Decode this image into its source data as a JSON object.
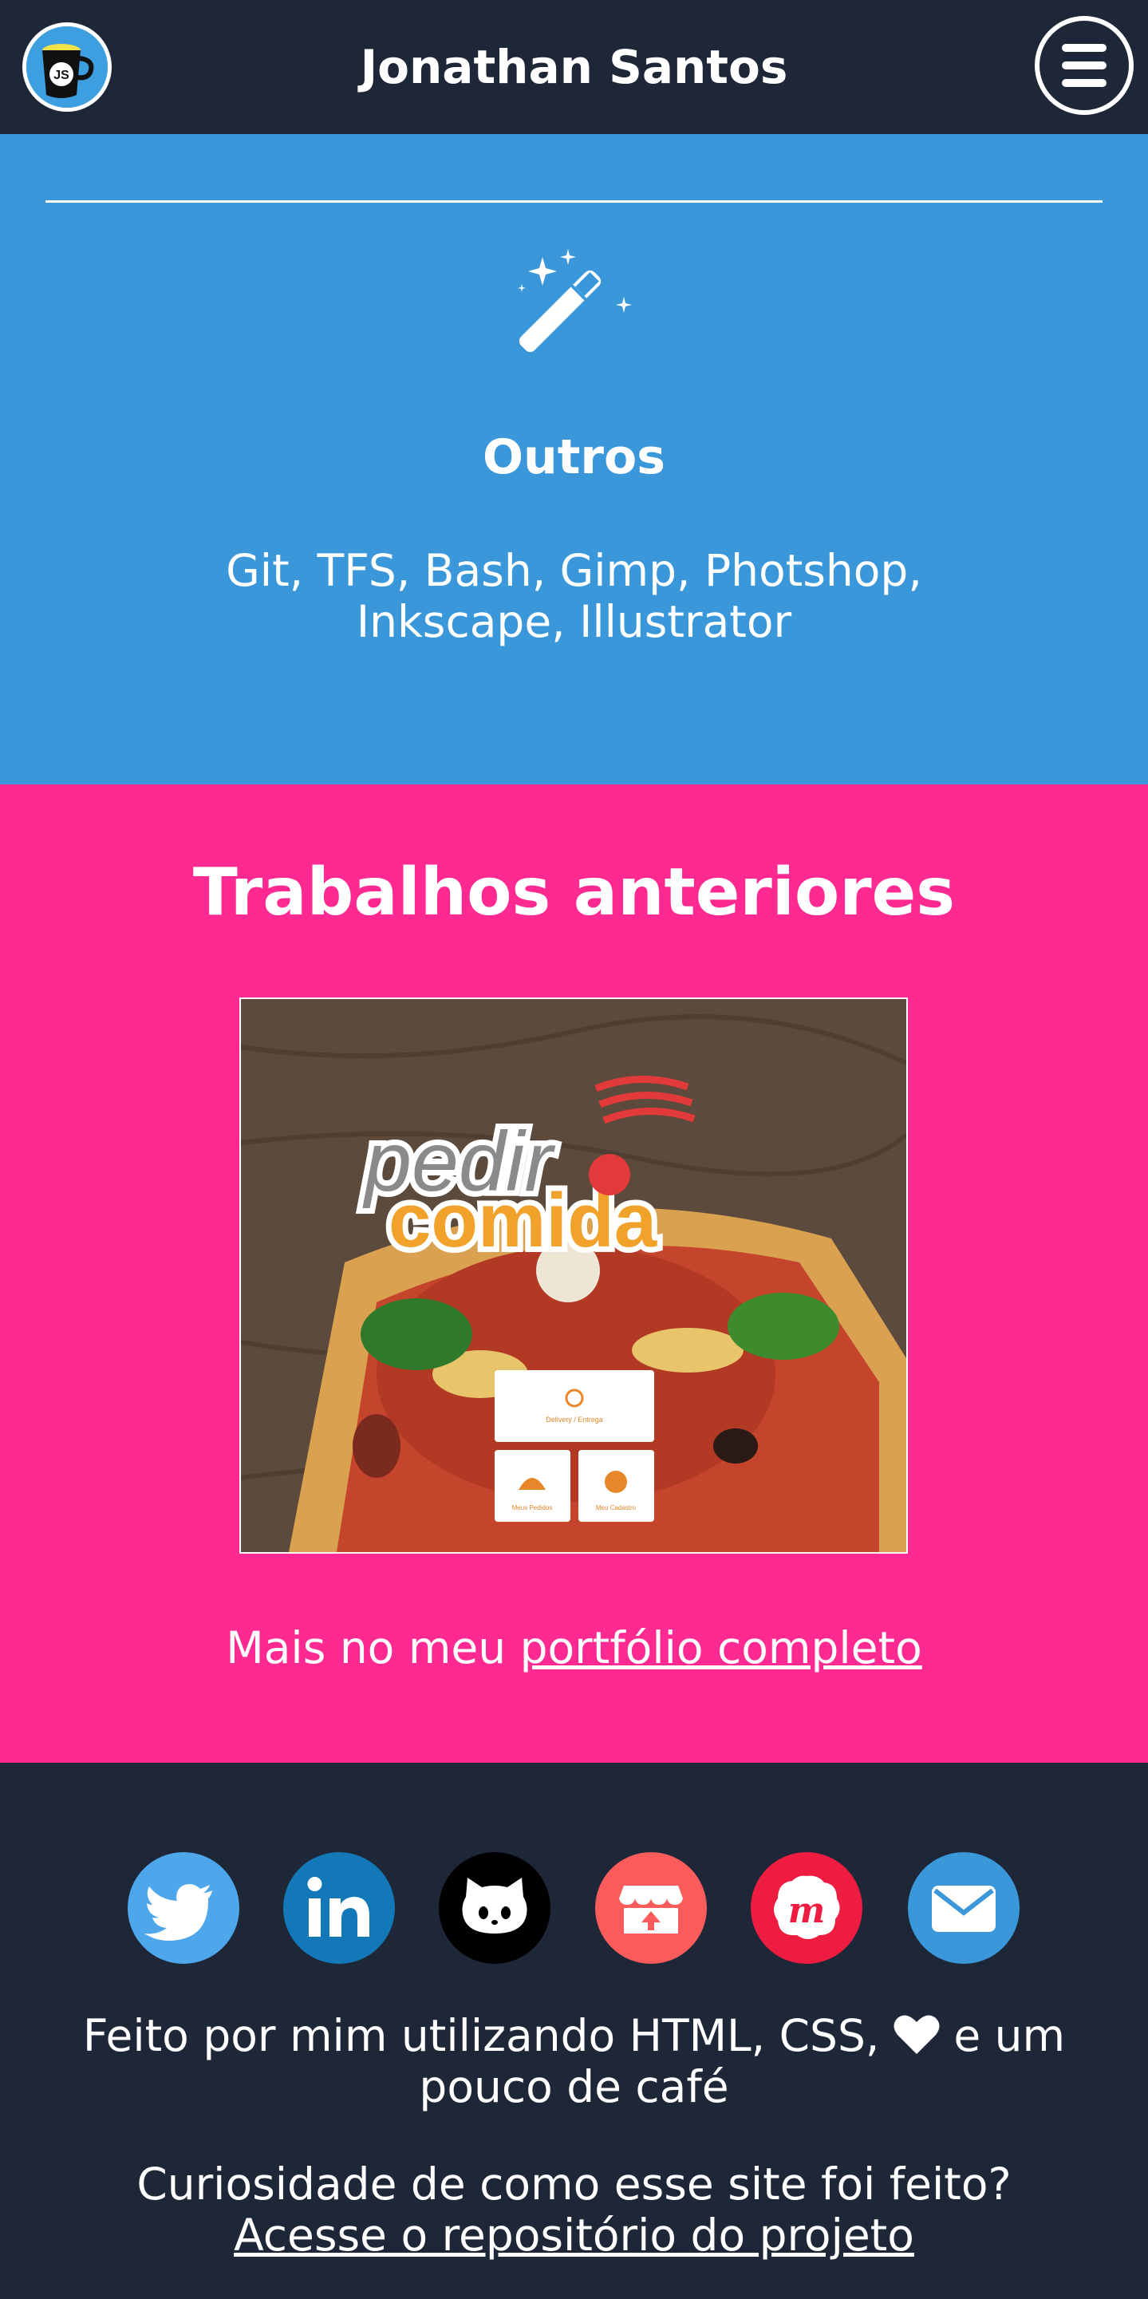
{
  "header": {
    "title": "Jonathan Santos",
    "logo_text": "JS",
    "logo_icon": "coffee-mug-logo-icon",
    "menu_icon": "hamburger-menu-icon"
  },
  "skills": {
    "icon": "magic-wand-icon",
    "title": "Outros",
    "text": "Git, TFS, Bash, Gimp, Photshop, Inkscape, Illustrator"
  },
  "works": {
    "title": "Trabalhos anteriores",
    "project": {
      "logo_line1": "pedir",
      "logo_line2": "comida",
      "card_delivery": "Delivery / Entrega",
      "card_menu": "Meus Pedidos",
      "card_account": "Meu Cadastro"
    },
    "more_prefix": "Mais no meu ",
    "more_link": "portfólio completo"
  },
  "footer": {
    "social": [
      {
        "name": "twitter-icon",
        "color": "#4da7ea"
      },
      {
        "name": "linkedin-icon",
        "color": "#1378b8"
      },
      {
        "name": "github-icon",
        "color": "#000000"
      },
      {
        "name": "itchio-icon",
        "color": "#fa5c5c"
      },
      {
        "name": "meetup-icon",
        "color": "#ed1c40"
      },
      {
        "name": "email-icon",
        "color": "#3a97da"
      }
    ],
    "credits_before": "Feito por mim utilizando HTML, CSS,",
    "credits_after": "e um pouco de café",
    "repo_prefix": "Curiosidade de como esse site foi feito? ",
    "repo_link": "Acesse o repositório do projeto"
  },
  "colors": {
    "header_bg": "#1e2738",
    "skills_bg": "#3a97da",
    "works_bg": "#fe2a92"
  }
}
